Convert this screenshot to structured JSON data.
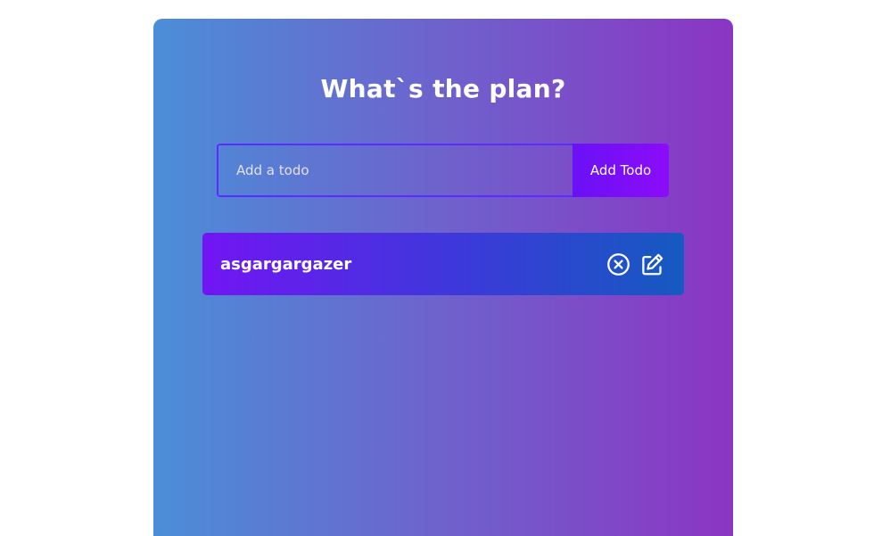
{
  "header": {
    "title": "What`s the plan?"
  },
  "form": {
    "input_value": "",
    "placeholder": "Add a todo",
    "add_label": "Add Todo"
  },
  "todos": [
    {
      "text": "asgargargazer",
      "icons": [
        "close-circle-icon",
        "edit-icon"
      ]
    }
  ],
  "colors": {
    "background_gradient": [
      "#4b8ed8",
      "#8b35c4"
    ],
    "button_gradient": [
      "#6a11f5",
      "#8c0cf8"
    ],
    "todo_row_gradient": [
      "#7215f3",
      "#155ac0"
    ],
    "input_border": "#5b2cff",
    "text": "#ffffff"
  }
}
